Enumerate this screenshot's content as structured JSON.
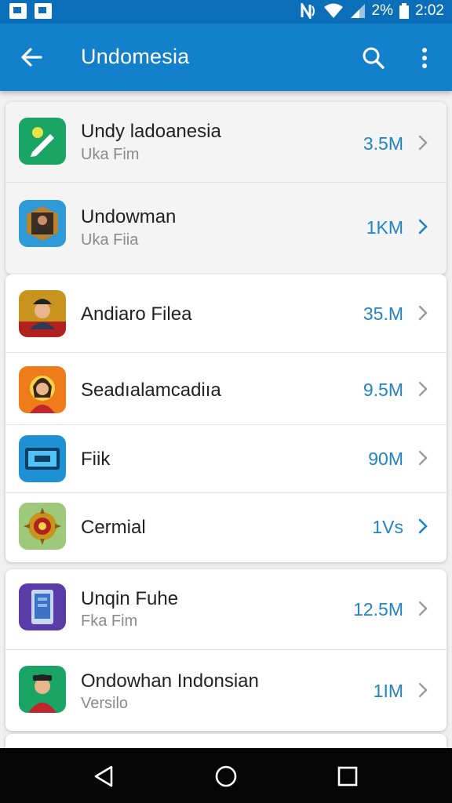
{
  "status_bar": {
    "battery_text": "2%",
    "time": "2:02",
    "left_icons": [
      "image-notification-icon",
      "photo-notification-icon"
    ],
    "right_icons": [
      "nfc-icon",
      "wifi-icon",
      "signal-icon",
      "battery-icon"
    ]
  },
  "app_bar": {
    "title": "Undomesia",
    "icons": [
      "back-arrow-icon",
      "search-icon",
      "more-vert-icon"
    ]
  },
  "groups": [
    {
      "items": [
        {
          "title": "Undy ladoanesia",
          "subtitle": "Uka Fim",
          "size": "3.5M",
          "icon": "green-edit-app-icon"
        },
        {
          "title": "Undowman",
          "subtitle": "Uka Fiia",
          "size": "1KM",
          "icon": "portrait-frame-app-icon"
        }
      ]
    },
    {
      "items": [
        {
          "title": "Andiaro Filea",
          "subtitle": "",
          "size": "35.M",
          "icon": "officer-portrait-app-icon"
        },
        {
          "title": "Seadıalamcadiıa",
          "subtitle": "",
          "size": "9.5M",
          "icon": "woman-portrait-app-icon"
        },
        {
          "title": "Fiik",
          "subtitle": "",
          "size": "90M",
          "icon": "tv-app-icon"
        },
        {
          "title": "Cermial",
          "subtitle": "",
          "size": "1Vs",
          "icon": "emblem-app-icon"
        }
      ]
    },
    {
      "items": [
        {
          "title": "Unqin Fuhe",
          "subtitle": "Fka Fim",
          "size": "12.5M",
          "icon": "tablet-app-icon"
        },
        {
          "title": "Ondowhan Indonsian",
          "subtitle": "Versilo",
          "size": "1IM",
          "icon": "man-portrait-app-icon"
        }
      ]
    }
  ],
  "nav_bar": {
    "icons": [
      "back-triangle-icon",
      "home-circle-icon",
      "recents-square-icon"
    ]
  },
  "colors": {
    "app_bar": "#1380cc",
    "status_bar": "#0a6fb8",
    "size_text": "#1f83c5",
    "nav_bar": "#050505"
  }
}
